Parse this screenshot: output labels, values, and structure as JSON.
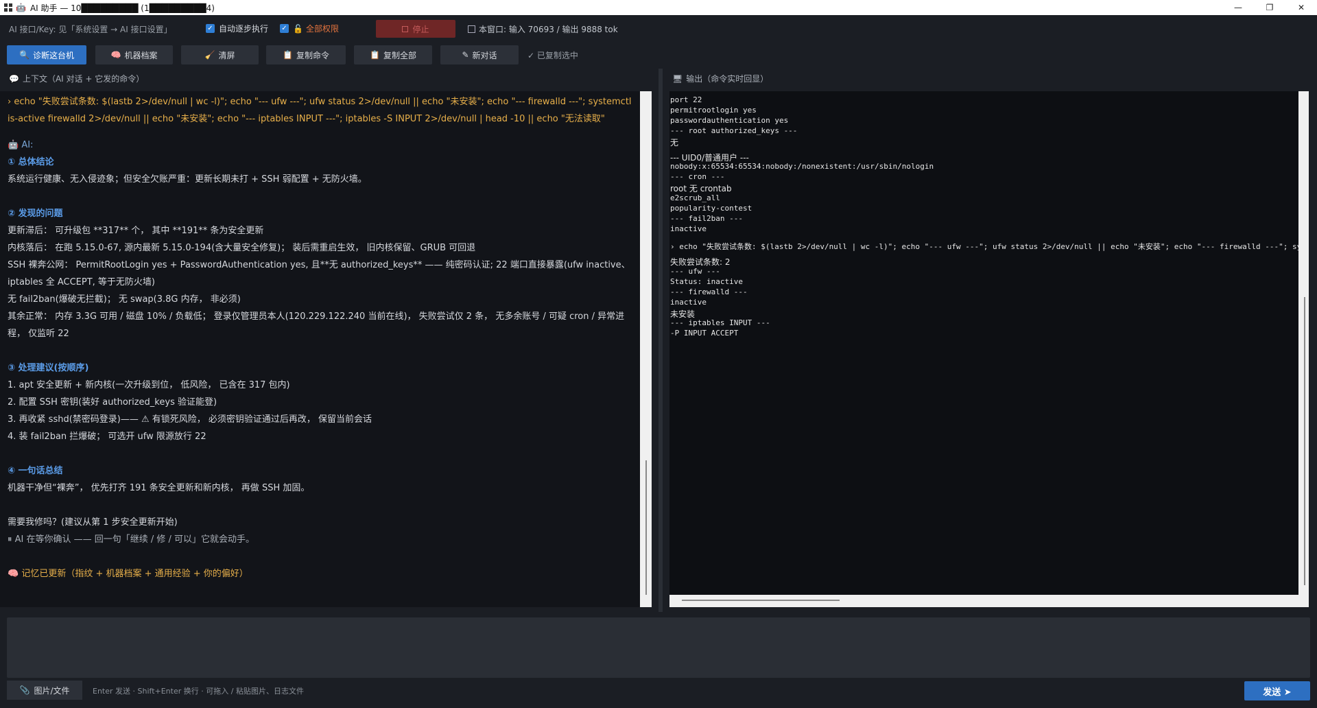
{
  "window": {
    "title": "AI 助手 — 10█████████ (1█████████4)",
    "controls": [
      "—",
      "❐",
      "✕"
    ]
  },
  "top": {
    "api_hint": "AI 接口/Key: 见「系统设置 → AI 接口设置」",
    "auto_step_label": "自动逐步执行",
    "full_perm_label": "全部权限",
    "stop_label": "停止",
    "token_info": "本窗口: 输入 70693 / 输出 9888 tok"
  },
  "toolbar": {
    "diagnose": "诊断这台机",
    "profile": "机器档案",
    "clear": "清屏",
    "copy_cmd": "复制命令",
    "copy_all": "复制全部",
    "new_chat": "新对话",
    "copied": "✓ 已复制选中"
  },
  "panels": {
    "left_header": "上下文（AI 对话 + 它发的命令）",
    "right_header": "输出（命令实时回显）"
  },
  "conversation": {
    "cmd": "› echo \"失败尝试条数: $(lastb 2>/dev/null | wc -l)\"; echo \"--- ufw ---\"; ufw status 2>/dev/null || echo \"未安装\"; echo \"--- firewalld ---\"; systemctl is-active firewalld 2>/dev/null || echo \"未安装\"; echo \"--- iptables INPUT ---\"; iptables -S INPUT 2>/dev/null | head -10 || echo \"无法读取\"",
    "ai_label": "🤖 AI:",
    "h1": "① 总体结论",
    "p1": "系统运行健康、无入侵迹象；但安全欠账严重：更新长期未打 + SSH 弱配置 + 无防火墙。",
    "h2": "② 发现的问题",
    "p2a": "  更新滞后：  可升级包 **317** 个，  其中 **191** 条为安全更新",
    "p2b": "  内核落后：  在跑 5.15.0-67, 源内最新 5.15.0-194(含大量安全修复)；  装后需重启生效，  旧内核保留、GRUB 可回退",
    "p2c": "  SSH 裸奔公网：  PermitRootLogin yes + PasswordAuthentication yes, 且**无 authorized_keys** —— 纯密码认证; 22 端口直接暴露(ufw inactive、iptables 全 ACCEPT, 等于无防火墙)",
    "p2d": "  无 fail2ban(爆破无拦截)；  无 swap(3.8G 内存，  非必须)",
    "p2e": "  其余正常：  内存 3.3G 可用 / 磁盘 10% / 负载低；  登录仅管理员本人(120.229.122.240 当前在线)，  失败尝试仅 2 条，  无多余账号 / 可疑 cron / 异常进程，  仅监听 22",
    "h3": "③ 处理建议(按顺序)",
    "s1": "1. apt 安全更新 + 新内核(一次升级到位，  低风险，  已含在 317 包内)",
    "s2": "2. 配置 SSH 密钥(装好 authorized_keys 验证能登)",
    "s3": "3. 再收紧 sshd(禁密码登录)—— ⚠ 有锁死风险，  必须密钥验证通过后再改，  保留当前会话",
    "s4": "4. 装 fail2ban 拦爆破；  可选开 ufw 限源放行 22",
    "h4": "④ 一句话总结",
    "p4": "机器干净但“裸奔”，  优先打齐 191 条安全更新和新内核，  再做 SSH 加固。",
    "q": "需要我修吗？(建议从第 1 步安全更新开始)",
    "wait": "⏸ AI 在等你确认 —— 回一句「继续 / 修 / 可以」它就会动手。",
    "mem": "🧠 记忆已更新（指纹 + 机器档案 + 通用经验 + 你的偏好）"
  },
  "terminal": {
    "lines": [
      "port 22",
      "permitrootlogin yes",
      "passwordauthentication yes",
      "--- root authorized_keys ---",
      "无",
      "--- UID0/普通用户 ---",
      "nobody:x:65534:65534:nobody:/nonexistent:/usr/sbin/nologin",
      "--- cron ---",
      "root 无 crontab",
      "e2scrub_all",
      "popularity-contest",
      "--- fail2ban ---",
      "inactive",
      "› echo \"失败尝试条数: $(lastb 2>/dev/null | wc -l)\"; echo \"--- ufw ---\"; ufw status 2>/dev/null || echo \"未安装\"; echo \"--- firewalld ---\"; systemctl",
      "失败尝试条数: 2",
      "--- ufw ---",
      "Status: inactive",
      "--- firewalld ---",
      "inactive",
      "未安装",
      "--- iptables INPUT ---",
      "-P INPUT ACCEPT"
    ]
  },
  "bottom": {
    "attach": "图片/文件",
    "hint": "Enter 发送 · Shift+Enter 换行 · 可拖入 / 粘贴图片、日志文件",
    "send": "发送 ➤"
  }
}
